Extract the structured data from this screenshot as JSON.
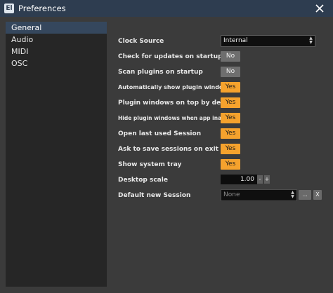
{
  "window": {
    "title": "Preferences",
    "logo_text": "El"
  },
  "sidebar": {
    "items": [
      {
        "label": "General"
      },
      {
        "label": "Audio"
      },
      {
        "label": "MIDI"
      },
      {
        "label": "OSC"
      }
    ]
  },
  "settings": {
    "clock_source": {
      "label": "Clock Source",
      "value": "Internal"
    },
    "check_updates": {
      "label": "Check for updates on startup",
      "value": "No"
    },
    "scan_plugins": {
      "label": "Scan plugins on startup",
      "value": "No"
    },
    "auto_show_plugin": {
      "label": "Automatically show plugin windows",
      "value": "Yes"
    },
    "plugin_on_top": {
      "label": "Plugin windows on top by default",
      "value": "Yes"
    },
    "hide_plugin_inactive": {
      "label": "Hide plugin windows when app inactive",
      "value": "Yes"
    },
    "open_last_session": {
      "label": "Open last used Session",
      "value": "Yes"
    },
    "ask_save_exit": {
      "label": "Ask to save sessions on exit",
      "value": "Yes"
    },
    "show_tray": {
      "label": "Show system tray",
      "value": "Yes"
    },
    "desktop_scale": {
      "label": "Desktop scale",
      "value": "1.00",
      "decrement": "-",
      "increment": "+"
    },
    "default_session": {
      "label": "Default new Session",
      "value": "None",
      "browse_label": "...",
      "clear_label": "X"
    }
  },
  "colors": {
    "accent_yes": "#f5a22d",
    "toggle_no": "#6e6e6e",
    "selected_nav": "#35475d",
    "titlebar": "#2e3d50"
  }
}
